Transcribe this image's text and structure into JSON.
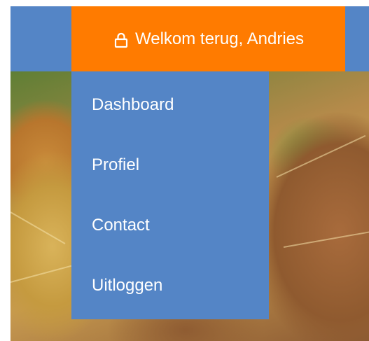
{
  "header": {
    "account_label": "Welkom terug, Andries",
    "account_icon": "lock-icon"
  },
  "menu": {
    "items": [
      {
        "label": "Dashboard"
      },
      {
        "label": "Profiel"
      },
      {
        "label": "Contact"
      },
      {
        "label": "Uitloggen"
      }
    ]
  },
  "colors": {
    "nav_blue": "#5485c6",
    "accent_orange": "#ff7b00",
    "text": "#ffffff"
  }
}
